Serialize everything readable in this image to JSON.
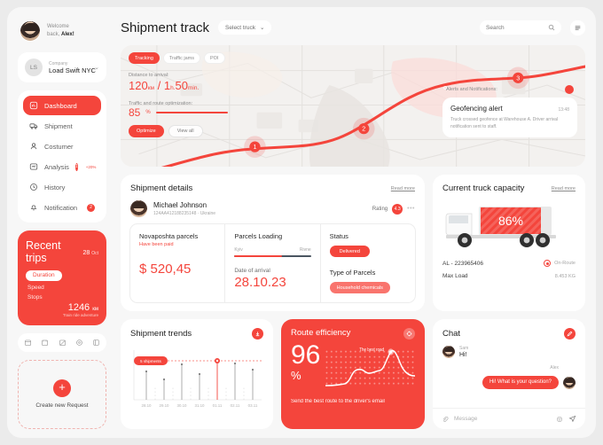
{
  "sidebar": {
    "welcome_line1": "Welcome",
    "welcome_line2_pre": "back, ",
    "welcome_name": "Alex!",
    "company_label": "Company",
    "company_name": "Load Swift NYC",
    "company_initials": "LS",
    "nav": [
      {
        "label": "Dashboard",
        "icon": "dashboard-icon",
        "badge": "",
        "delta": ""
      },
      {
        "label": "Shipment",
        "icon": "truck-icon",
        "badge": "",
        "delta": ""
      },
      {
        "label": "Costumer",
        "icon": "user-icon",
        "badge": "",
        "delta": ""
      },
      {
        "label": "Analysis",
        "icon": "chart-icon",
        "badge": "1",
        "delta": "+20%"
      },
      {
        "label": "History",
        "icon": "clock-icon",
        "badge": "",
        "delta": ""
      },
      {
        "label": "Notification",
        "icon": "bell-icon",
        "badge": "2",
        "delta": ""
      }
    ],
    "trips": {
      "title": "Recent trips",
      "date_num": "28",
      "date_unit": "Oct",
      "options": [
        "Duration",
        "Speed",
        "Stops"
      ],
      "selected_option": "Duration",
      "distance": "1246",
      "distance_unit": "км",
      "subtitle": "Train ride adventure"
    },
    "quick_icons": [
      "calendar-icon",
      "archive-icon",
      "layers-icon",
      "settings-icon",
      "book-icon"
    ],
    "create": {
      "label": "Create new Request",
      "plus": "+"
    }
  },
  "topbar": {
    "title": "Shipment track",
    "select_truck": "Select truck",
    "search_placeholder": "Search",
    "menu_icon": "hamburger-icon"
  },
  "map": {
    "chips": [
      {
        "label": "Tracking",
        "active": true
      },
      {
        "label": "Traffic jams",
        "active": false
      },
      {
        "label": "POI",
        "active": false
      }
    ],
    "distance_label": "Distance to arrival:",
    "distance_km": "120",
    "distance_km_unit": "км",
    "distance_sep": "/",
    "time_h": "1",
    "time_h_unit": "h.",
    "time_m": "50",
    "time_m_unit": "min.",
    "traffic_label": "Traffic and route optimization:",
    "traffic_value": "85",
    "traffic_unit": "%",
    "optimize_btn": "Optimize",
    "view_all_btn": "View all",
    "markers": [
      "1",
      "2",
      "3"
    ],
    "alerts_label": "Alerts and Notifications:",
    "alert_title": "Geofencing alert",
    "alert_time": "13:48",
    "alert_body": "Truck crossed geofence at Warehouse A. Driver arrival notification sent to staff."
  },
  "shipment_details": {
    "title": "Shipment details",
    "read_more": "Read more",
    "driver_name": "Michael Johnson",
    "driver_id": "124AA412188235148 · Ukraine",
    "rating_label": "Rating",
    "rating_value": "4.3",
    "more_icon": "more-dots-icon",
    "parcels_title": "Novaposhta parcels",
    "parcels_sub": "Have been paid",
    "amount": "$ 520,45",
    "loading_title": "Parcels Loading",
    "loading_from": "Kyiv",
    "loading_to": "Rivne",
    "loading_percent": 62,
    "date_label": "Date of arrival",
    "date_value": "28.10.23",
    "status_label": "Status",
    "status_value": "Delivered",
    "type_label": "Type of Parcels",
    "type_value": "Household chemicals"
  },
  "truck_capacity": {
    "title": "Current truck capacity",
    "read_more": "Read more",
    "capacity": "86%",
    "plate_label": "AL - 223965406",
    "status": "On-Route",
    "max_load_label": "Max Load",
    "max_load_value": "8.453 KG"
  },
  "chart_data": {
    "type": "bar",
    "title": "Shipment trends",
    "categories": [
      "28.10",
      "29.10",
      "30.10",
      "31.10",
      "01.11",
      "02.11",
      "03.11"
    ],
    "values": [
      54,
      38,
      70,
      46,
      100,
      72,
      58
    ],
    "ylim": [
      0,
      100
    ],
    "xlabel": "",
    "ylabel": "",
    "grid": false,
    "badge": "5 shipments",
    "highlight_index": 4,
    "download_icon": "download-icon"
  },
  "route_efficiency": {
    "title": "Route efficiency",
    "value": "96",
    "unit": "%",
    "tooltip": "The best road",
    "footer": "Send the best route to the driver's email",
    "icon": "target-icon",
    "curve": [
      {
        "x": 0,
        "y": 46
      },
      {
        "x": 12,
        "y": 46
      },
      {
        "x": 24,
        "y": 44
      },
      {
        "x": 36,
        "y": 30
      },
      {
        "x": 46,
        "y": 26
      },
      {
        "x": 56,
        "y": 32
      },
      {
        "x": 66,
        "y": 30
      },
      {
        "x": 76,
        "y": 14
      },
      {
        "x": 84,
        "y": 6
      },
      {
        "x": 92,
        "y": 20
      },
      {
        "x": 100,
        "y": 34
      },
      {
        "x": 112,
        "y": 35
      }
    ]
  },
  "chat": {
    "title": "Chat",
    "edit_icon": "edit-icon",
    "messages": [
      {
        "sender": "Sam",
        "text": "Hi!",
        "me": false
      },
      {
        "sender": "Alex",
        "text": "Hi! What is your question?",
        "me": true
      }
    ],
    "input_placeholder": "Message",
    "attach_icon": "attachment-icon",
    "emoji_icon": "emoji-icon",
    "send_icon": "send-icon"
  },
  "colors": {
    "accent": "#f4453c",
    "bg": "#f7f7f7",
    "card": "#ffffff"
  }
}
